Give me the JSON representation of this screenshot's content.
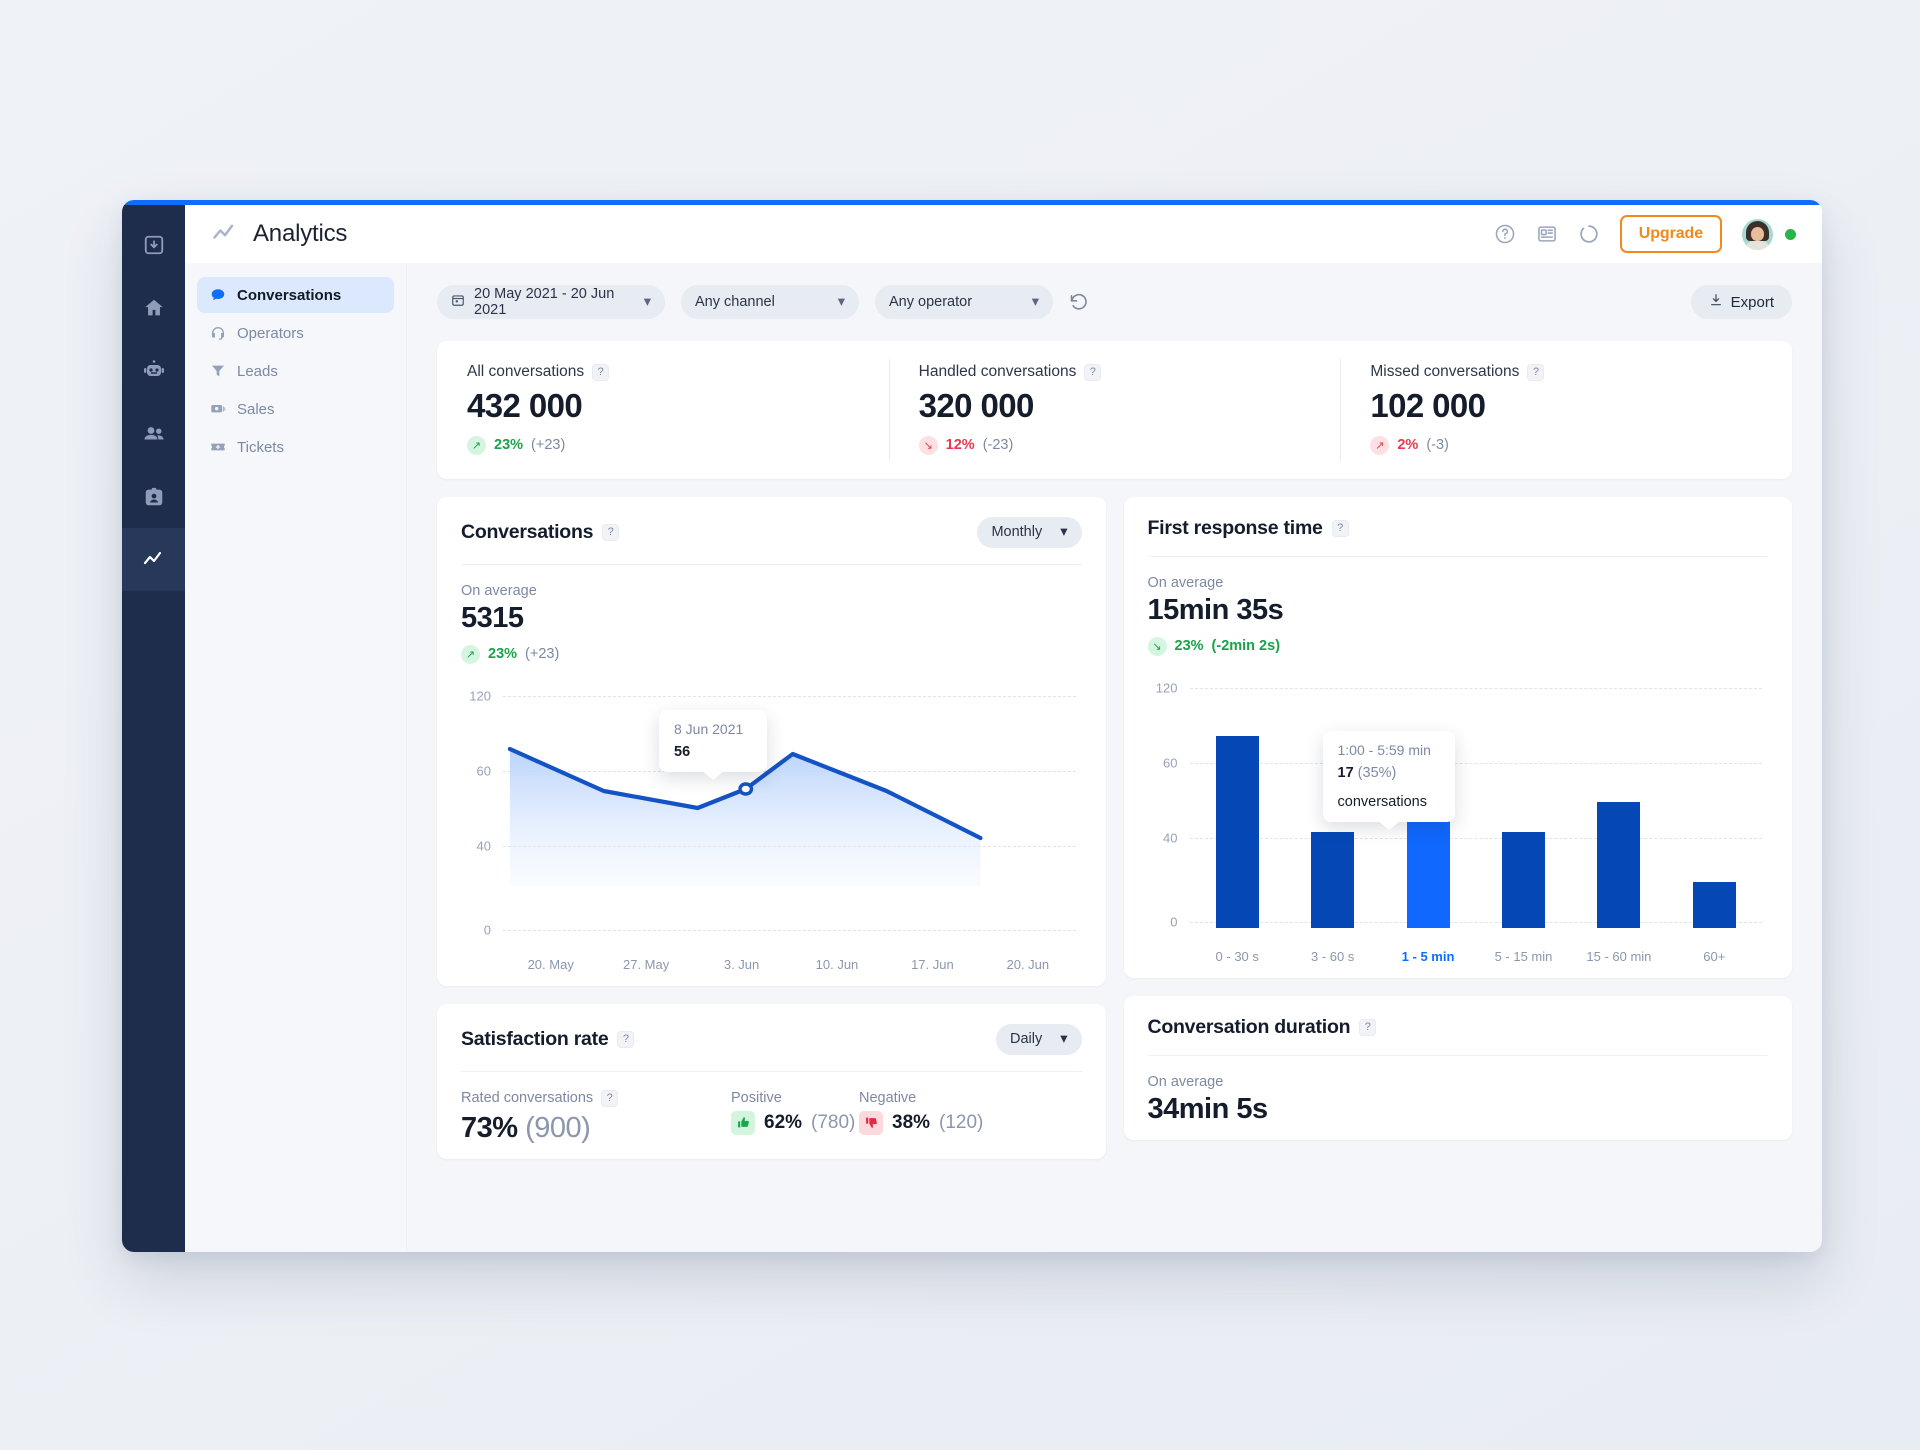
{
  "window": {
    "accent": "#0d6efd"
  },
  "rail": {
    "items": [
      {
        "name": "inbox-icon",
        "active": false
      },
      {
        "name": "home-icon",
        "active": false
      },
      {
        "name": "chatbot-icon",
        "active": false
      },
      {
        "name": "contacts-icon",
        "active": false
      },
      {
        "name": "id-card-icon",
        "active": false
      },
      {
        "name": "analytics-icon",
        "active": true
      }
    ]
  },
  "topbar": {
    "title": "Analytics",
    "upgrade_label": "Upgrade",
    "icons": [
      "help-circle-icon",
      "news-icon",
      "refresh-spinner-icon"
    ],
    "status": "online"
  },
  "sidebar": {
    "items": [
      {
        "label": "Conversations",
        "icon": "chat-bubble-icon",
        "active": true
      },
      {
        "label": "Operators",
        "icon": "headset-icon",
        "active": false
      },
      {
        "label": "Leads",
        "icon": "funnel-icon",
        "active": false
      },
      {
        "label": "Sales",
        "icon": "money-icon",
        "active": false
      },
      {
        "label": "Tickets",
        "icon": "ticket-icon",
        "active": false
      }
    ]
  },
  "filters": {
    "date_range": "20 May 2021 - 20 Jun 2021",
    "channel": "Any channel",
    "operator": "Any operator",
    "reset_icon": "reset-icon",
    "export_label": "Export"
  },
  "kpis": [
    {
      "label": "All conversations",
      "value": "432 000",
      "delta": "23%",
      "delta_sub": "(+23)",
      "direction": "up"
    },
    {
      "label": "Handled conversations",
      "value": "320 000",
      "delta": "12%",
      "delta_sub": "(-23)",
      "direction": "down"
    },
    {
      "label": "Missed conversations",
      "value": "102 000",
      "delta": "2%",
      "delta_sub": "(-3)",
      "direction": "up-bad"
    }
  ],
  "cards": {
    "conversations": {
      "title": "Conversations",
      "granularity": "Monthly",
      "avg_label": "On average",
      "avg_value": "5315",
      "delta": "23%",
      "delta_sub": "(+23)",
      "direction": "up"
    },
    "first_response": {
      "title": "First response time",
      "avg_label": "On average",
      "avg_value": "15min 35s",
      "delta": "23%",
      "delta_sub": "(-2min 2s)",
      "direction": "down-good"
    },
    "satisfaction": {
      "title": "Satisfaction rate",
      "granularity": "Daily",
      "rated_label": "Rated conversations",
      "rated_value": "73%",
      "rated_count": "(900)",
      "positive_label": "Positive",
      "positive_value": "62%",
      "positive_count": "(780)",
      "negative_label": "Negative",
      "negative_value": "38%",
      "negative_count": "(120)"
    },
    "duration": {
      "title": "Conversation duration",
      "avg_label": "On average",
      "avg_value": "34min 5s"
    }
  },
  "chart_data": [
    {
      "type": "area",
      "title": "Conversations",
      "xlabel": "",
      "ylabel": "",
      "x": [
        "20. May",
        "27. May",
        "3. Jun",
        "10. Jun",
        "17. Jun",
        "20. Jun"
      ],
      "tick_labels": [
        "20. May",
        "27. May",
        "3. Jun",
        "10. Jun",
        "17. Jun",
        "20. Jun"
      ],
      "y_ticks": [
        "120",
        "60",
        "40",
        "0"
      ],
      "ylim": [
        0,
        120
      ],
      "grid": true,
      "legend": "none",
      "series": [
        {
          "name": "Conversations",
          "values": [
            66,
            52,
            48,
            56,
            63,
            53,
            38
          ]
        }
      ],
      "points_x": [
        "20. May",
        "27. May",
        "3. Jun",
        "8. Jun",
        "10. Jun",
        "17. Jun",
        "20. Jun"
      ],
      "line_color": "#1453c4",
      "annotation": {
        "date": "8 Jun 2021",
        "value": "56"
      }
    },
    {
      "type": "bar",
      "title": "First response time",
      "xlabel": "",
      "ylabel": "",
      "categories": [
        "0 - 30 s",
        "3 - 60 s",
        "1 - 5 min",
        "5 - 15 min",
        "15 - 60 min",
        "60+"
      ],
      "values": [
        68,
        31,
        42,
        31,
        44,
        16
      ],
      "y_ticks": [
        "120",
        "60",
        "40",
        "0"
      ],
      "ylim": [
        0,
        120
      ],
      "grid": true,
      "legend": "none",
      "bar_color": "#0548b5",
      "highlight_index": 2,
      "highlight_color": "#1068ff",
      "annotation": {
        "range": "1:00 - 5:59 min",
        "value": "17",
        "percent": "(35%)",
        "unit": "conversations"
      }
    }
  ]
}
